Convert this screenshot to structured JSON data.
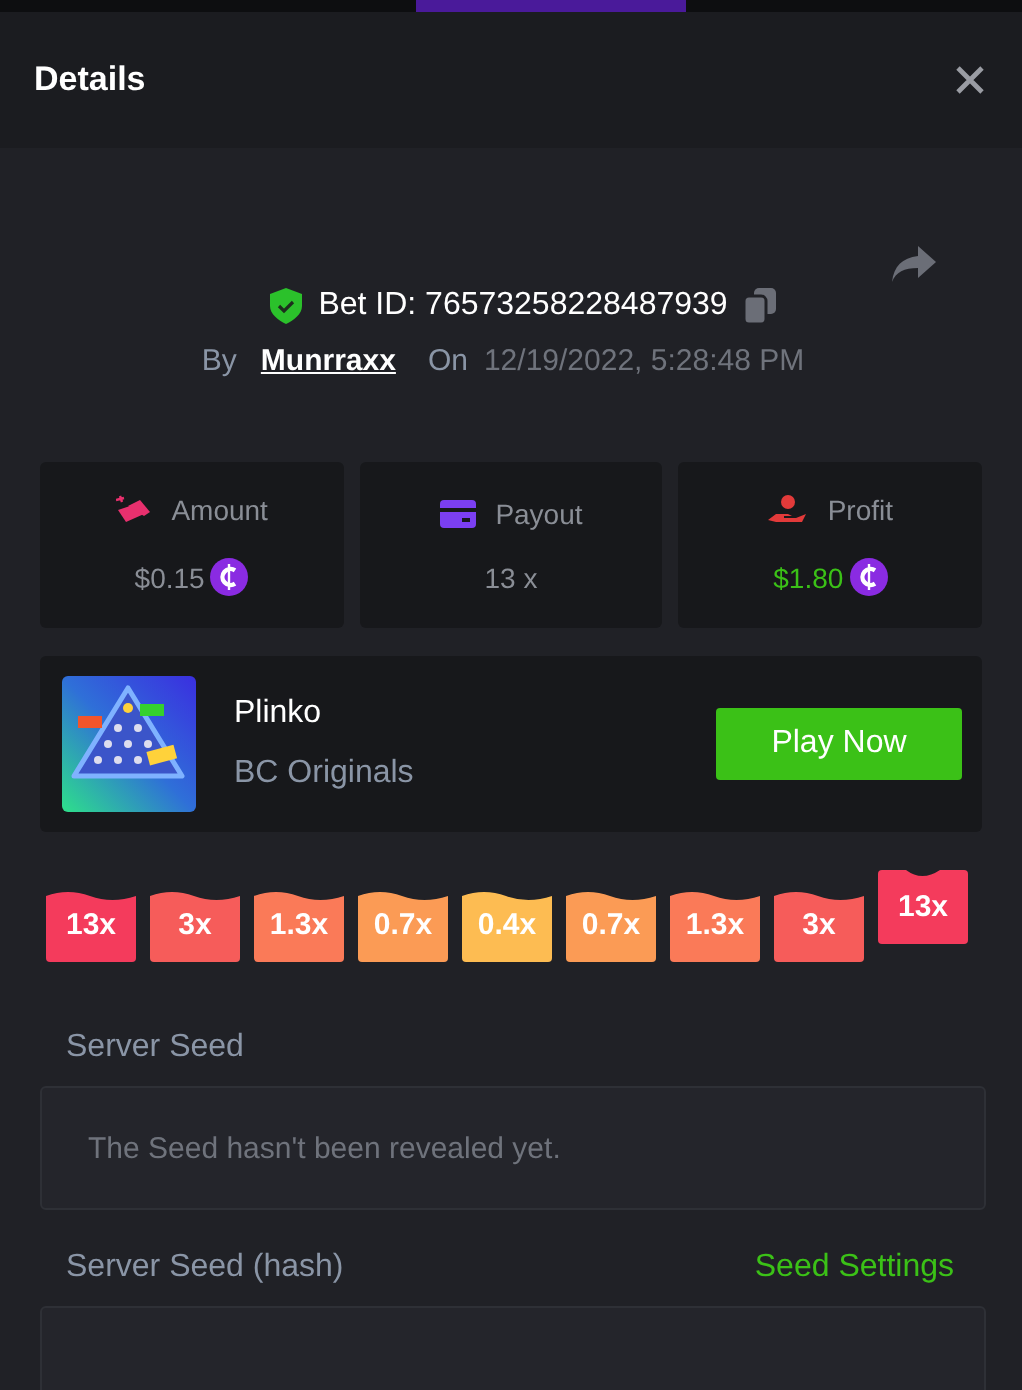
{
  "header": {
    "title": "Details"
  },
  "bet": {
    "id_label": "Bet ID: 76573258228487939",
    "by_label": "By",
    "user": "Munrraxx",
    "on_label": "On",
    "date": "12/19/2022, 5:28:48 PM"
  },
  "stats": [
    {
      "kind": "amount",
      "label": "Amount",
      "value": "$0.15",
      "coin": true,
      "positive": false
    },
    {
      "kind": "payout",
      "label": "Payout",
      "value": "13 x",
      "coin": false,
      "positive": false
    },
    {
      "kind": "profit",
      "label": "Profit",
      "value": "$1.80",
      "coin": true,
      "positive": true
    }
  ],
  "game": {
    "name": "Plinko",
    "provider": "BC Originals",
    "button": "Play Now"
  },
  "multipliers": [
    {
      "label": "13x",
      "color": "#f43b5c",
      "selected": false
    },
    {
      "label": "3x",
      "color": "#f65c5a",
      "selected": false
    },
    {
      "label": "1.3x",
      "color": "#fa7a58",
      "selected": false
    },
    {
      "label": "0.7x",
      "color": "#fb9b55",
      "selected": false
    },
    {
      "label": "0.4x",
      "color": "#fdbc52",
      "selected": false
    },
    {
      "label": "0.7x",
      "color": "#fb9b55",
      "selected": false
    },
    {
      "label": "1.3x",
      "color": "#fa7a58",
      "selected": false
    },
    {
      "label": "3x",
      "color": "#f65c5a",
      "selected": false
    },
    {
      "label": "13x",
      "color": "#f43b5c",
      "selected": true
    }
  ],
  "server_seed": {
    "label": "Server Seed",
    "value": "The Seed hasn't been revealed yet."
  },
  "server_seed_hash": {
    "label": "Server Seed (hash)",
    "link": "Seed Settings"
  }
}
